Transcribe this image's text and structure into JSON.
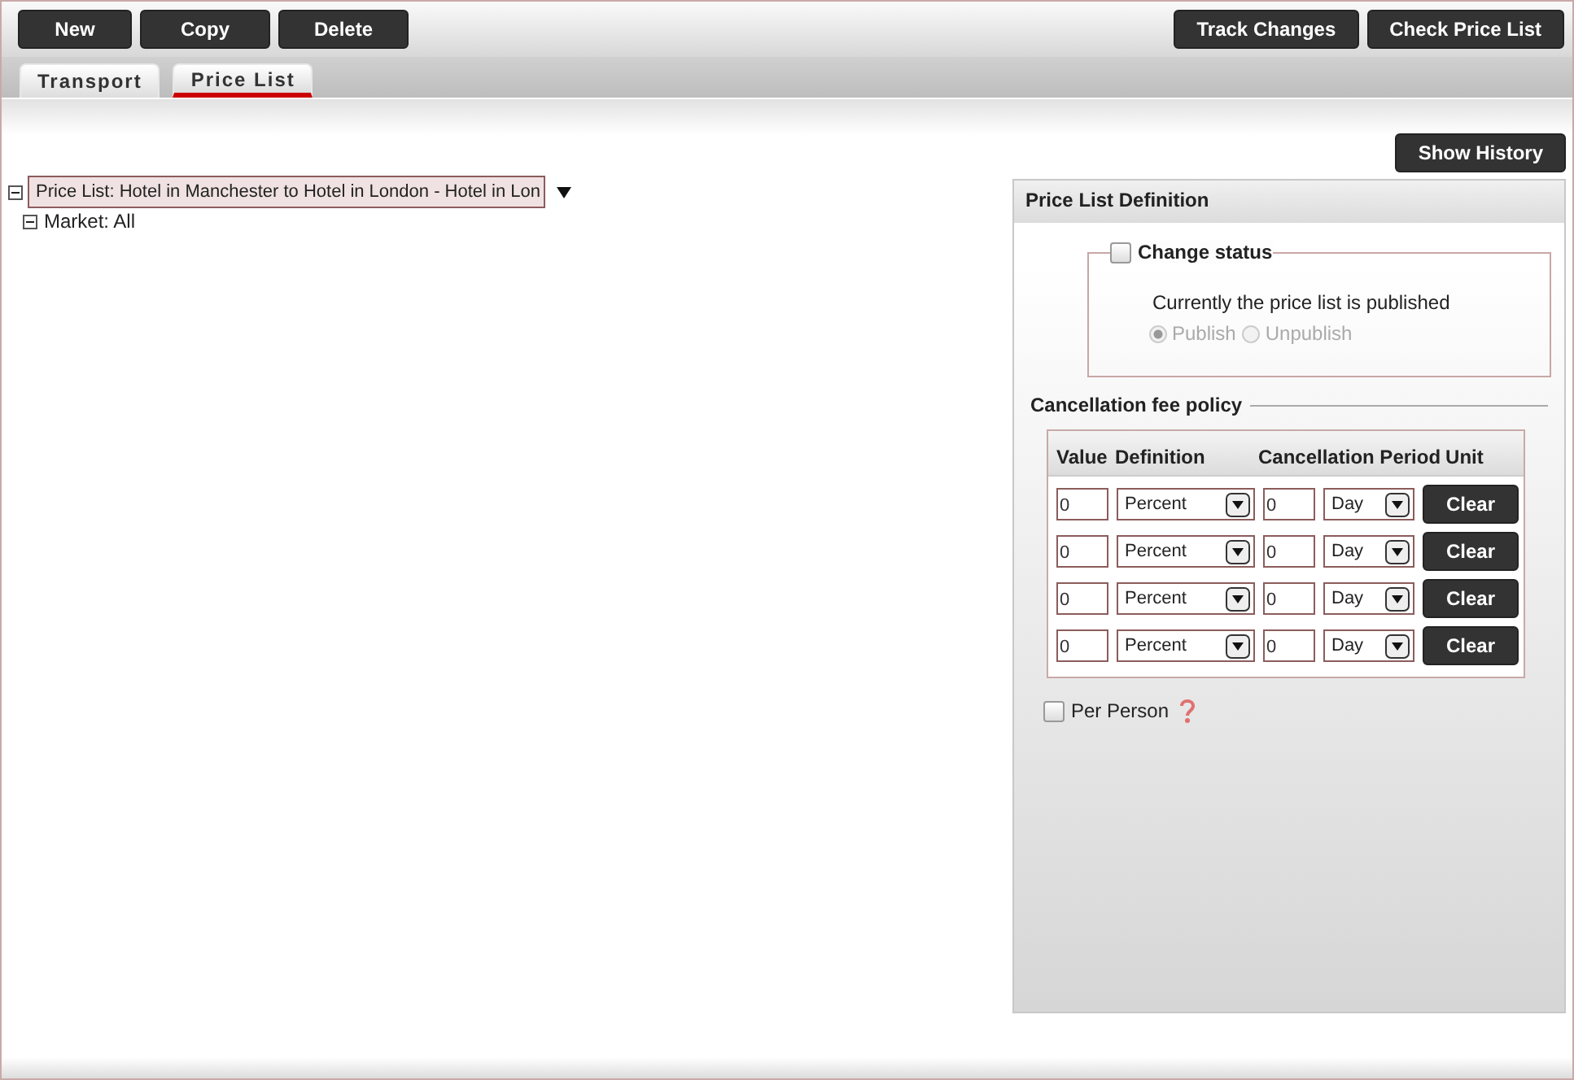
{
  "toolbar": {
    "left_buttons": [
      "New",
      "Copy",
      "Delete"
    ],
    "right_buttons": [
      "Track Changes",
      "Check Price List"
    ]
  },
  "tabs": [
    {
      "label": "Transport",
      "selected": false
    },
    {
      "label": "Price List",
      "selected": true
    }
  ],
  "show_history_button": "Show History",
  "tree": [
    {
      "label": "Price List: Hotel in Manchester to Hotel in London - Hotel in Lon",
      "expanded": true,
      "selected": true,
      "children": [
        {
          "label": "Market: All",
          "expanded": true,
          "selected": false
        }
      ]
    }
  ],
  "panel": {
    "title": "Price List Definition",
    "change_status": {
      "label": "Change status",
      "checked": false,
      "message": "Currently the price list is published",
      "options": [
        {
          "label": "Publish",
          "selected": true,
          "disabled": true
        },
        {
          "label": "Unpublish",
          "selected": false,
          "disabled": true
        }
      ]
    },
    "fee_policy": {
      "title": "Cancellation fee policy",
      "columns": [
        "Value",
        "Definition",
        "Cancellation Period",
        "Unit"
      ],
      "rows": [
        {
          "value": "0",
          "definition": "Percent",
          "period": "0",
          "unit": "Day",
          "button": "Clear"
        },
        {
          "value": "0",
          "definition": "Percent",
          "period": "0",
          "unit": "Day",
          "button": "Clear"
        },
        {
          "value": "0",
          "definition": "Percent",
          "period": "0",
          "unit": "Day",
          "button": "Clear"
        },
        {
          "value": "0",
          "definition": "Percent",
          "period": "0",
          "unit": "Day",
          "button": "Clear"
        }
      ]
    },
    "per_person": {
      "label": "Per Person",
      "checked": false
    }
  }
}
